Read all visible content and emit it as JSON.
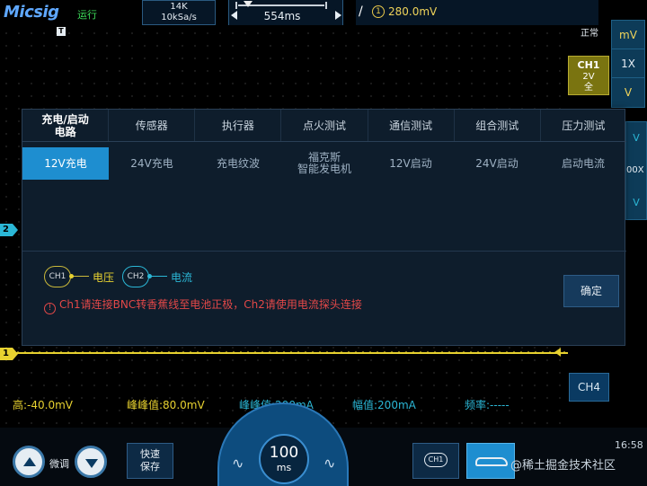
{
  "topbar": {
    "logo": "Micsig",
    "run_status": "运行",
    "memory_depth": "14K",
    "sample_rate": "10kSa/s",
    "timebase": "554ms",
    "trigger_edge": "/",
    "trigger_source": "1",
    "trigger_level": "280.0mV"
  },
  "screen": {
    "t_marker": "T",
    "ch2_marker": "2",
    "ch1_marker": "1",
    "measurements": {
      "high": "高:-40.0mV",
      "pk2pk_ch1": "峰峰值:80.0mV",
      "pk2pk_ch2": "峰峰值:200mA",
      "amplitude": "幅值:200mA",
      "frequency": "频率:-----"
    }
  },
  "right_panel": {
    "mode": "正常",
    "ch1_badge": {
      "name": "CH1",
      "scale": "2V",
      "coupling": "全"
    },
    "col_top": [
      "mV",
      "1X",
      "V"
    ],
    "col_mid": [
      "V",
      "00X",
      "V"
    ],
    "ch4_label": "CH4"
  },
  "dialog": {
    "tabs": [
      "充电/启动\n电路",
      "传感器",
      "执行器",
      "点火测试",
      "通信测试",
      "组合测试",
      "压力测试"
    ],
    "active_tab": 0,
    "subtabs": [
      "12V充电",
      "24V充电",
      "充电纹波",
      "福克斯\n智能发电机",
      "12V启动",
      "24V启动",
      "启动电流"
    ],
    "active_subtab": 0,
    "probe1": {
      "badge": "CH1",
      "label": "电压"
    },
    "probe2": {
      "badge": "CH2",
      "label": "电流"
    },
    "warning_icon": "!",
    "warning": "Ch1请连接BNC转香蕉线至电池正极，Ch2请使用电流探头连接",
    "confirm_label": "确定"
  },
  "bottombar": {
    "fine_label": "微调",
    "save_label": "快速\n保存",
    "dial_value": "100",
    "dial_unit": "ms",
    "ch1_btn_label": "CH1",
    "clock": "16:58",
    "watermark": "@稀土掘金技术社区"
  },
  "colors": {
    "ch1": "#e8d230",
    "ch2": "#2bb7d6",
    "accent": "#1e8ed0",
    "warning": "#e34848"
  }
}
